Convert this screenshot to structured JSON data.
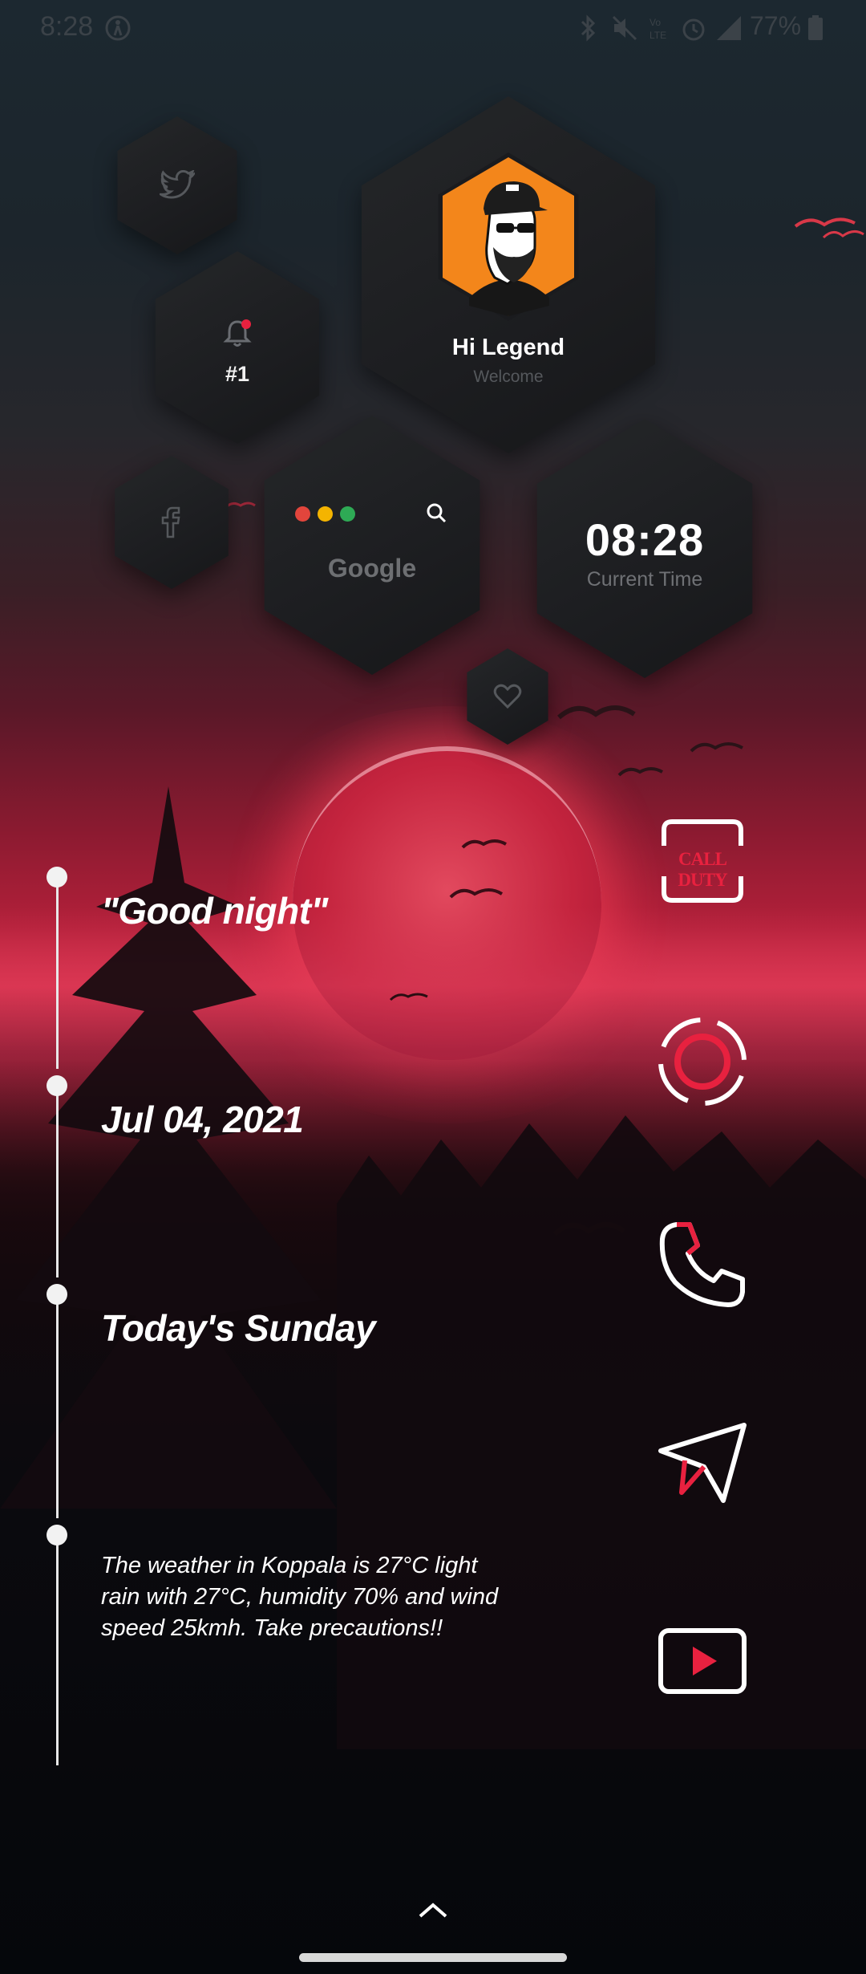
{
  "status_bar": {
    "time": "8:28",
    "battery": "77%",
    "icons": [
      "accessibility-icon",
      "bluetooth-icon",
      "mute-icon",
      "volte-icon",
      "alarm-icon",
      "lte-signal-icon",
      "battery-icon"
    ]
  },
  "widgets": {
    "twitter": {
      "icon": "twitter-icon"
    },
    "notifications": {
      "icon": "bell-icon",
      "count": "#1"
    },
    "profile": {
      "greeting": "Hi Legend",
      "subtitle": "Welcome",
      "avatar": "avatar"
    },
    "facebook": {
      "icon": "facebook-icon"
    },
    "google": {
      "label": "Google",
      "dot_colors": [
        "#e2453c",
        "#f4b400",
        "#2eaa55"
      ],
      "icon": "search-icon"
    },
    "clock": {
      "time": "08:28",
      "label": "Current Time"
    },
    "favorite": {
      "icon": "heart-icon"
    }
  },
  "timeline": {
    "items": [
      {
        "text": "\"Good night\""
      },
      {
        "text": "Jul 04, 2021"
      },
      {
        "text": "Today's Sunday"
      },
      {
        "text": "The weather in Koppala is 27°C light rain with 27°C, humidity 70% and wind speed 25kmh. Take precautions!!"
      }
    ]
  },
  "apps": [
    {
      "name": "call-of-duty",
      "label": "CALL DUTY"
    },
    {
      "name": "camera",
      "icon": "camera-ring-icon"
    },
    {
      "name": "phone",
      "icon": "phone-icon"
    },
    {
      "name": "telegram",
      "icon": "send-icon"
    },
    {
      "name": "youtube",
      "icon": "youtube-icon"
    }
  ],
  "colors": {
    "accent": "#e8213f",
    "hex_bg": "#1d1e21",
    "text_muted": "#6f7175",
    "icon_muted": "#55585c"
  }
}
